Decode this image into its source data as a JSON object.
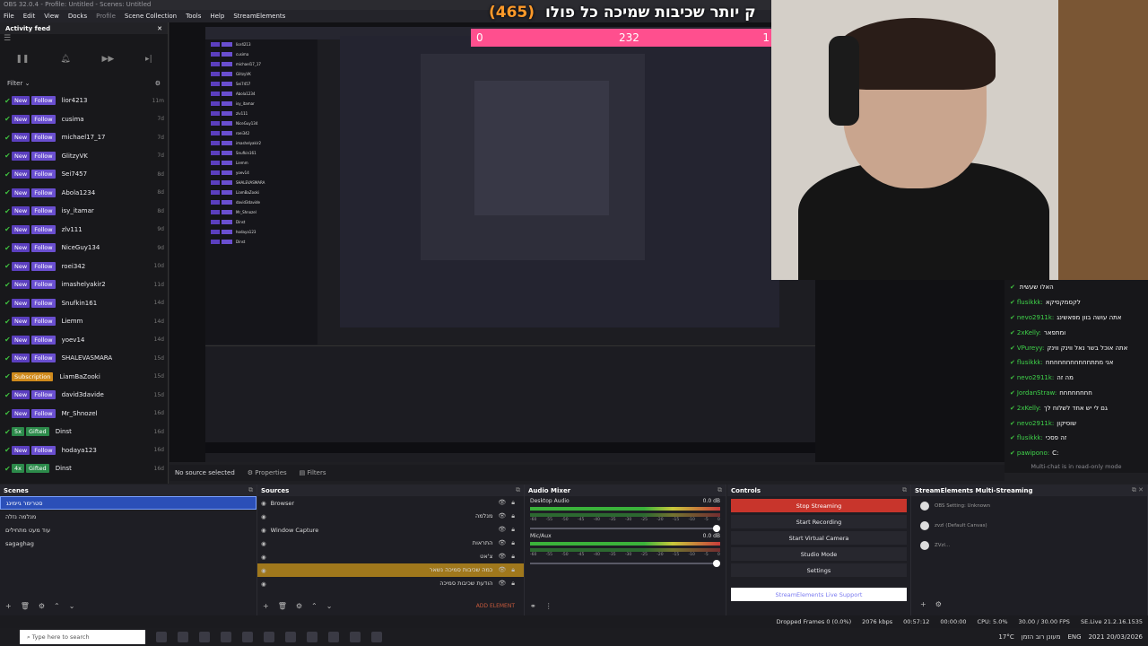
{
  "window_title": "OBS 32.0.4 - Profile: Untitled - Scenes: Untitled",
  "menu": [
    "File",
    "Edit",
    "View",
    "Docks",
    "Profile",
    "Scene Collection",
    "Tools",
    "Help",
    "StreamElements"
  ],
  "activity": {
    "title": "Activity feed",
    "filter_label": "Filter",
    "events": [
      {
        "badge1": "New",
        "badge2": "Follow",
        "user": "lior4213",
        "age": "11m"
      },
      {
        "badge1": "New",
        "badge2": "Follow",
        "user": "cusima",
        "age": "7d"
      },
      {
        "badge1": "New",
        "badge2": "Follow",
        "user": "michael17_17",
        "age": "7d"
      },
      {
        "badge1": "New",
        "badge2": "Follow",
        "user": "GlitzyVK",
        "age": "7d"
      },
      {
        "badge1": "New",
        "badge2": "Follow",
        "user": "Sei7457",
        "age": "8d"
      },
      {
        "badge1": "New",
        "badge2": "Follow",
        "user": "Abola1234",
        "age": "8d"
      },
      {
        "badge1": "New",
        "badge2": "Follow",
        "user": "isy_itamar",
        "age": "8d"
      },
      {
        "badge1": "New",
        "badge2": "Follow",
        "user": "zlv111",
        "age": "9d"
      },
      {
        "badge1": "New",
        "badge2": "Follow",
        "user": "NiceGuy134",
        "age": "9d"
      },
      {
        "badge1": "New",
        "badge2": "Follow",
        "user": "roei342",
        "age": "10d"
      },
      {
        "badge1": "New",
        "badge2": "Follow",
        "user": "imashelyakir2",
        "age": "11d"
      },
      {
        "badge1": "New",
        "badge2": "Follow",
        "user": "Snufkin161",
        "age": "14d"
      },
      {
        "badge1": "New",
        "badge2": "Follow",
        "user": "Liemm",
        "age": "14d"
      },
      {
        "badge1": "New",
        "badge2": "Follow",
        "user": "yoev14",
        "age": "14d"
      },
      {
        "badge1": "New",
        "badge2": "Follow",
        "user": "SHALEVASMARA",
        "age": "15d"
      },
      {
        "badge1": "",
        "badge2": "Subscription",
        "user": "LiamBaZooki",
        "age": "15d"
      },
      {
        "badge1": "New",
        "badge2": "Follow",
        "user": "david3davide",
        "age": "15d"
      },
      {
        "badge1": "New",
        "badge2": "Follow",
        "user": "Mr_Shnozel",
        "age": "16d"
      },
      {
        "badge1": "5x",
        "badge2": "Gifted",
        "user": "Dinst",
        "age": "16d"
      },
      {
        "badge1": "New",
        "badge2": "Follow",
        "user": "hodaya123",
        "age": "16d"
      },
      {
        "badge1": "4x",
        "badge2": "Gifted",
        "user": "Dinst",
        "age": "16d"
      }
    ]
  },
  "overlay": {
    "goal_count": "(465)",
    "goal_text": "ק יותר שכיבות שמיכה כל פולו",
    "bar_left": "0",
    "bar_mid": "232",
    "bar_right": "1"
  },
  "chat": {
    "lines": [
      {
        "name": "",
        "msg": "האלו שעשית"
      },
      {
        "name": "flusikkk:",
        "msg": "לקסמקסיקא"
      },
      {
        "name": "nevo2911k:",
        "msg": "אתה עושה בוון מפאשינג"
      },
      {
        "name": "2xKelly:",
        "msg": "ומתפאר"
      },
      {
        "name": "VPureyy:",
        "msg": "אתה אוכל בשר נאל ווינק ווינק"
      },
      {
        "name": "flusikkk:",
        "msg": "אני מתתחחחחחחחחחחח"
      },
      {
        "name": "nevo2911k:",
        "msg": "מה זה"
      },
      {
        "name": "JordanStraw:",
        "msg": "חחחחחחחח"
      },
      {
        "name": "2xKelly:",
        "msg": "גם לי יש אחד לשלוח לך"
      },
      {
        "name": "nevo2911k:",
        "msg": "שוסיקון"
      },
      {
        "name": "flusikkk:",
        "msg": "זה פסכי"
      },
      {
        "name": "pawipono:",
        "msg": "C:"
      }
    ],
    "readonly": "Multi-chat is in read-only mode"
  },
  "srcbar": {
    "no_source": "No source selected",
    "properties": "Properties",
    "filters": "Filters"
  },
  "scenes": {
    "title": "Scenes",
    "items": [
      "סטרימר גיימינג",
      "מנלמה נזלה",
      "עוד מעט מתחילים",
      "sagaghag"
    ]
  },
  "sources": {
    "title": "Sources",
    "items": [
      {
        "name": "Browser",
        "right": ""
      },
      {
        "name": "",
        "right": "מנלמה"
      },
      {
        "name": "Window Capture",
        "right": ""
      },
      {
        "name": "",
        "right": "התראות"
      },
      {
        "name": "",
        "right": "צ'אט"
      },
      {
        "name": "",
        "right": "כמה שכיבות סמיכה נשאר"
      },
      {
        "name": "",
        "right": "הודעת שכיבות סמיכה"
      }
    ],
    "add_element": "ADD ELEMENT"
  },
  "mixer": {
    "title": "Audio Mixer",
    "channels": [
      {
        "name": "Desktop Audio",
        "db": "0.0 dB"
      },
      {
        "name": "Mic/Aux",
        "db": "0.0 dB"
      }
    ],
    "scale": [
      "-60",
      "-55",
      "-50",
      "-45",
      "-40",
      "-35",
      "-30",
      "-25",
      "-20",
      "-15",
      "-10",
      "-5",
      "0"
    ]
  },
  "controls": {
    "title": "Controls",
    "buttons": [
      "Stop Streaming",
      "Start Recording",
      "Start Virtual Camera",
      "Studio Mode",
      "Settings"
    ],
    "se_support": "StreamElements Live Support"
  },
  "multi": {
    "title": "StreamElements Multi-Streaming",
    "rows": [
      {
        "label": "OBS Setting: Unknown"
      },
      {
        "label": "zvzl (Default Canvas)"
      },
      {
        "label": "ZVzl..."
      }
    ]
  },
  "status": {
    "dropped": "Dropped Frames 0 (0.0%)",
    "bitrate": "2076 kbps",
    "live_time": "00:57:12",
    "rec_time": "00:00:00",
    "cpu": "CPU: 5.0%",
    "fps": "30.00 / 30.00 FPS",
    "se_live": "SE.Live 21.2.16.1535"
  },
  "taskbar": {
    "search": "Type here to search",
    "temp": "17°C",
    "weather": "מעונן רוב הזמן",
    "lang": "ENG",
    "time": "2021",
    "date": "20/03/2026"
  }
}
